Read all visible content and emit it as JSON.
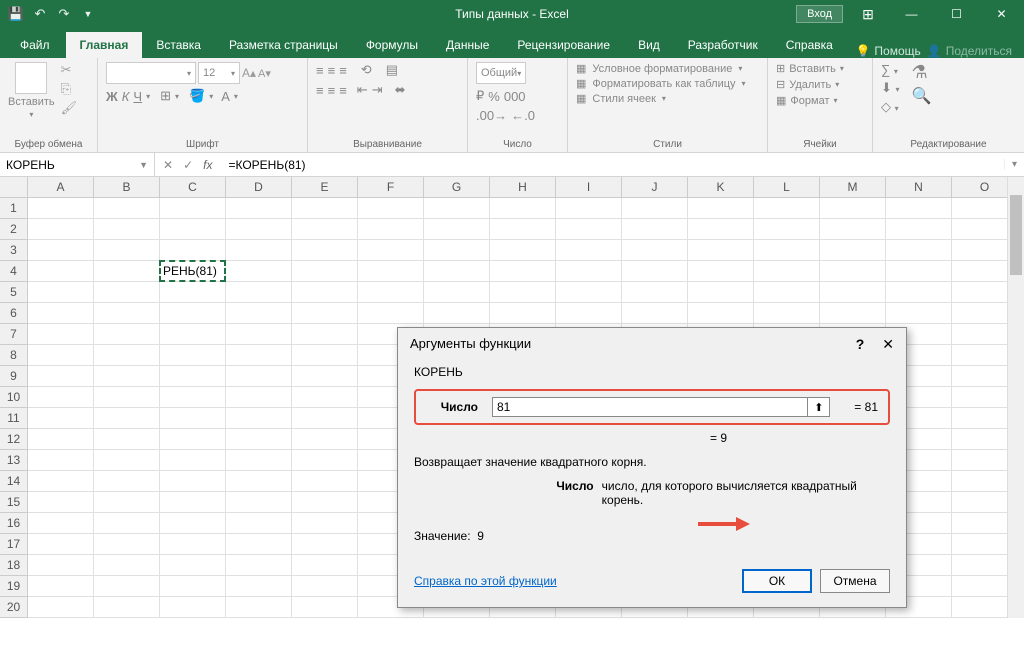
{
  "titlebar": {
    "title": "Типы данных - Excel",
    "login": "Вход"
  },
  "tabs": {
    "file": "Файл",
    "home": "Главная",
    "insert": "Вставка",
    "layout": "Разметка страницы",
    "formulas": "Формулы",
    "data": "Данные",
    "review": "Рецензирование",
    "view": "Вид",
    "developer": "Разработчик",
    "help_tab": "Справка",
    "tell_me": "Помощь",
    "share": "Поделиться"
  },
  "ribbon": {
    "clipboard": {
      "label": "Буфер обмена",
      "paste": "Вставить"
    },
    "font": {
      "label": "Шрифт",
      "size": "12",
      "bold": "Ж",
      "italic": "К",
      "underline": "Ч"
    },
    "alignment": {
      "label": "Выравнивание"
    },
    "number": {
      "label": "Число",
      "format": "Общий"
    },
    "styles": {
      "label": "Стили",
      "cond": "Условное форматирование",
      "table": "Форматировать как таблицу",
      "cell": "Стили ячеек"
    },
    "cells": {
      "label": "Ячейки",
      "insert": "Вставить",
      "delete": "Удалить",
      "format": "Формат"
    },
    "editing": {
      "label": "Редактирование"
    }
  },
  "formula_bar": {
    "namebox": "КОРЕНЬ",
    "formula": "=КОРЕНЬ(81)",
    "fx": "fx"
  },
  "grid": {
    "columns": [
      "A",
      "B",
      "C",
      "D",
      "E",
      "F",
      "G",
      "H",
      "I",
      "J",
      "K",
      "L",
      "M",
      "N",
      "O"
    ],
    "rows": [
      "1",
      "2",
      "3",
      "4",
      "5",
      "6",
      "7",
      "8",
      "9",
      "10",
      "11",
      "12",
      "13",
      "14",
      "15",
      "16",
      "17",
      "18",
      "19",
      "20"
    ],
    "active_cell_value": "РЕНЬ(81)"
  },
  "dialog": {
    "title": "Аргументы функции",
    "func_name": "КОРЕНЬ",
    "arg_label": "Число",
    "arg_value": "81",
    "arg_preview": "= 81",
    "result_preview": "= 9",
    "description": "Возвращает значение квадратного корня.",
    "arg_desc_label": "Число",
    "arg_desc": "число, для которого вычисляется квадратный корень.",
    "value_label": "Значение:",
    "value": "9",
    "help_link": "Справка по этой функции",
    "ok": "ОК",
    "cancel": "Отмена"
  }
}
